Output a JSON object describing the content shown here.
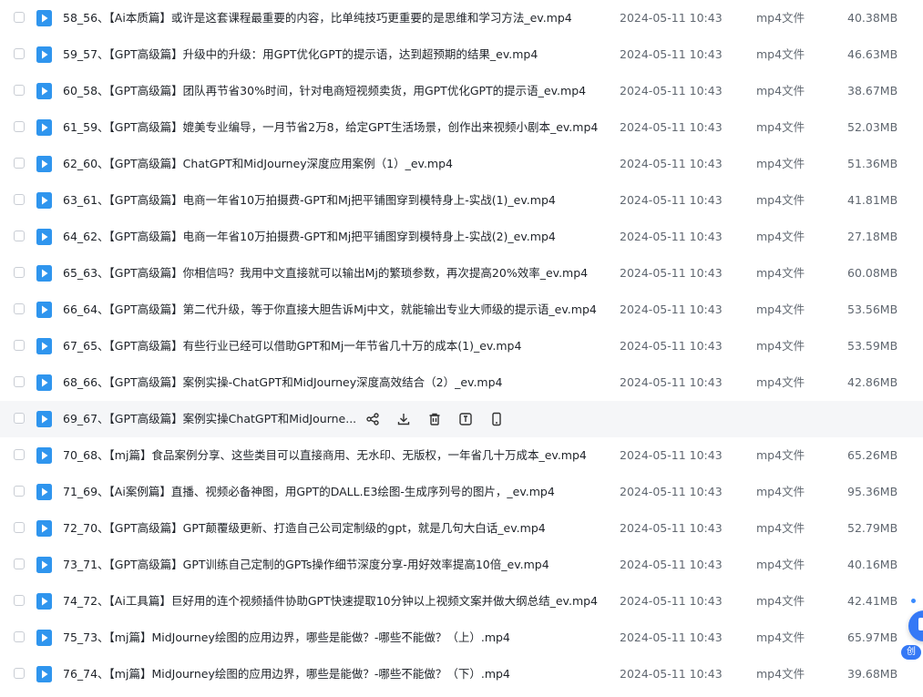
{
  "colors": {
    "file_icon_bg": "#2f95ee",
    "accent": "#3579f6",
    "hover_row": "#f5f6f8"
  },
  "rows": [
    {
      "name": "58_56、【Ai本质篇】或许是这套课程最重要的内容，比单纯技巧更重要的是思维和学习方法_ev.mp4",
      "date": "2024-05-11 10:43",
      "type": "mp4文件",
      "size": "40.38MB"
    },
    {
      "name": "59_57、【GPT高级篇】升级中的升级：用GPT优化GPT的提示语，达到超预期的结果_ev.mp4",
      "date": "2024-05-11 10:43",
      "type": "mp4文件",
      "size": "46.63MB"
    },
    {
      "name": "60_58、【GPT高级篇】团队再节省30%时间，针对电商短视频卖货，用GPT优化GPT的提示语_ev.mp4",
      "date": "2024-05-11 10:43",
      "type": "mp4文件",
      "size": "38.67MB"
    },
    {
      "name": "61_59、【GPT高级篇】媲美专业编导，一月节省2万8，给定GPT生活场景，创作出来视频小剧本_ev.mp4",
      "date": "2024-05-11 10:43",
      "type": "mp4文件",
      "size": "52.03MB"
    },
    {
      "name": "62_60、【GPT高级篇】ChatGPT和MidJourney深度应用案例（1）_ev.mp4",
      "date": "2024-05-11 10:43",
      "type": "mp4文件",
      "size": "51.36MB"
    },
    {
      "name": "63_61、【GPT高级篇】电商一年省10万拍摄费-GPT和Mj把平铺图穿到模特身上-实战(1)_ev.mp4",
      "date": "2024-05-11 10:43",
      "type": "mp4文件",
      "size": "41.81MB"
    },
    {
      "name": "64_62、【GPT高级篇】电商一年省10万拍摄费-GPT和Mj把平铺图穿到模特身上-实战(2)_ev.mp4",
      "date": "2024-05-11 10:43",
      "type": "mp4文件",
      "size": "27.18MB"
    },
    {
      "name": "65_63、【GPT高级篇】你相信吗？我用中文直接就可以输出Mj的繁琐参数，再次提高20%效率_ev.mp4",
      "date": "2024-05-11 10:43",
      "type": "mp4文件",
      "size": "60.08MB"
    },
    {
      "name": "66_64、【GPT高级篇】第二代升级，等于你直接大胆告诉Mj中文，就能输出专业大师级的提示语_ev.mp4",
      "date": "2024-05-11 10:43",
      "type": "mp4文件",
      "size": "53.56MB"
    },
    {
      "name": "67_65、【GPT高级篇】有些行业已经可以借助GPT和Mj一年节省几十万的成本(1)_ev.mp4",
      "date": "2024-05-11 10:43",
      "type": "mp4文件",
      "size": "53.59MB"
    },
    {
      "name": "68_66、【GPT高级篇】案例实操-ChatGPT和MidJourney深度高效结合（2）_ev.mp4",
      "date": "2024-05-11 10:43",
      "type": "mp4文件",
      "size": "42.86MB"
    },
    {
      "name": "69_67、【GPT高级篇】案例实操ChatGPT和MidJourne...",
      "hover": true
    },
    {
      "name": "70_68、【mj篇】食品案例分享、这些类目可以直接商用、无水印、无版权，一年省几十万成本_ev.mp4",
      "date": "2024-05-11 10:43",
      "type": "mp4文件",
      "size": "65.26MB"
    },
    {
      "name": "71_69、【Ai案例篇】直播、视频必备神图，用GPT的DALL.E3绘图-生成序列号的图片，_ev.mp4",
      "date": "2024-05-11 10:43",
      "type": "mp4文件",
      "size": "95.36MB"
    },
    {
      "name": "72_70、【GPT高级篇】GPT颠覆级更新、打造自己公司定制级的gpt，就是几句大白话_ev.mp4",
      "date": "2024-05-11 10:43",
      "type": "mp4文件",
      "size": "52.79MB"
    },
    {
      "name": "73_71、【GPT高级篇】GPT训练自己定制的GPTs操作细节深度分享-用好效率提高10倍_ev.mp4",
      "date": "2024-05-11 10:43",
      "type": "mp4文件",
      "size": "40.16MB"
    },
    {
      "name": "74_72、【Ai工具篇】巨好用的连个视频插件协助GPT快速提取10分钟以上视频文案并做大纲总结_ev.mp4",
      "date": "2024-05-11 10:43",
      "type": "mp4文件",
      "size": "42.41MB"
    },
    {
      "name": "75_73、【mj篇】MidJourney绘图的应用边界，哪些是能做？-哪些不能做？（上）.mp4",
      "date": "2024-05-11 10:43",
      "type": "mp4文件",
      "size": "65.97MB"
    },
    {
      "name": "76_74、【mj篇】MidJourney绘图的应用边界，哪些是能做？-哪些不能做？（下）.mp4",
      "date": "2024-05-11 10:43",
      "type": "mp4文件",
      "size": "39.68MB"
    }
  ],
  "hover_actions": [
    {
      "icon": "share-icon"
    },
    {
      "icon": "download-icon"
    },
    {
      "icon": "delete-icon"
    },
    {
      "icon": "rename-icon"
    },
    {
      "icon": "phone-icon"
    }
  ],
  "floating_widget": {
    "label": "创"
  }
}
